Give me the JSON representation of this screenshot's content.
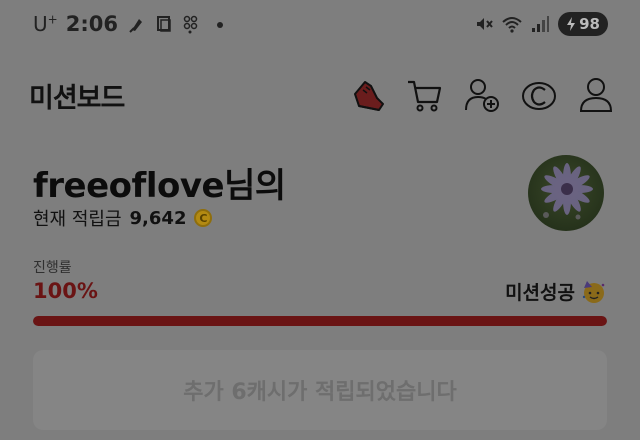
{
  "status_bar": {
    "carrier": "U",
    "carrier_sup": "+",
    "time": "2:06",
    "battery": "98",
    "icons": [
      "pin-icon",
      "copy-icon",
      "apps-grid-icon",
      "dot-icon",
      "mute-icon",
      "wifi-icon",
      "signal-icon",
      "battery-charging-icon"
    ]
  },
  "header": {
    "title": "미션보드",
    "icons": [
      "shoe-icon",
      "cart-icon",
      "add-friend-icon",
      "cash-icon",
      "profile-icon"
    ]
  },
  "profile": {
    "username": "freeoflove",
    "suffix": "님의",
    "points_label": "현재 적립금",
    "points_value": "9,642",
    "coin_symbol": "C"
  },
  "progress": {
    "label": "진행률",
    "value_text": "100%",
    "fraction": 1.0,
    "status_text": "미션성공",
    "bar_color": "#6a1414"
  },
  "cta": {
    "label": "추가 6캐시가 적립되었습니다"
  },
  "colors": {
    "overlay": "#7e7e7e",
    "accent": "#6a1414"
  }
}
